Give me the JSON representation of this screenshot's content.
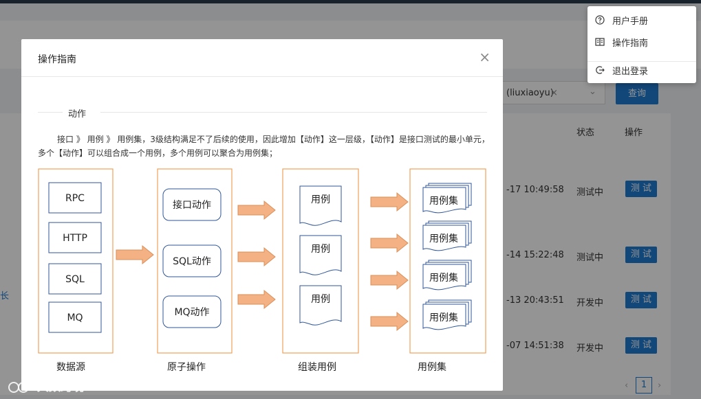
{
  "background": {
    "search_tag": "(liuxiaoyu)",
    "search_tag_close": "×",
    "query_button": "查询",
    "col_status": "状态",
    "col_action": "操作",
    "left_truncated": "长",
    "rows": [
      {
        "time": "-17 10:49:58",
        "status": "测试中",
        "action": "测 试"
      },
      {
        "time": "-14 15:22:48",
        "status": "测试中",
        "action": "测 试"
      },
      {
        "time": "-13 20:43:51",
        "status": "开发中",
        "action": "测 试"
      },
      {
        "time": "-07 14:51:38",
        "status": "开发中",
        "action": "测 试"
      }
    ],
    "pagination": {
      "prev": "‹",
      "current": "1",
      "next": "›"
    }
  },
  "user_menu": {
    "items": [
      {
        "label": "用户手册",
        "icon": "question-circle-icon"
      },
      {
        "label": "操作指南",
        "icon": "book-icon"
      },
      {
        "label": "退出登录",
        "icon": "logout-icon"
      }
    ]
  },
  "modal": {
    "title": "操作指南",
    "close": "×",
    "section_title": "动作",
    "description": "接口 》 用例 》 用例集，3级结构满足不了后续的使用，因此增加【动作】这一层级，【动作】是接口测试的最小单元，多个【动作】可以组合成一个用例，多个用例可以聚合为用例集；",
    "diagram": {
      "datasource": {
        "caption": "数据源",
        "items": [
          "RPC",
          "HTTP",
          "SQL",
          "MQ"
        ]
      },
      "atomic": {
        "caption": "原子操作",
        "items": [
          "接口动作",
          "SQL动作",
          "MQ动作"
        ]
      },
      "cases": {
        "caption": "组装用例",
        "items": [
          "用例",
          "用例",
          "用例"
        ]
      },
      "suites": {
        "caption": "用例集",
        "items": [
          "用例集",
          "用例集",
          "用例集",
          "用例集"
        ]
      }
    }
  },
  "watermark": "大数跨境",
  "colors": {
    "accent": "#1f7ad1",
    "orange": "#f0a05a",
    "arrow_fill": "#f4b183",
    "box_blue": "#2f5597"
  }
}
